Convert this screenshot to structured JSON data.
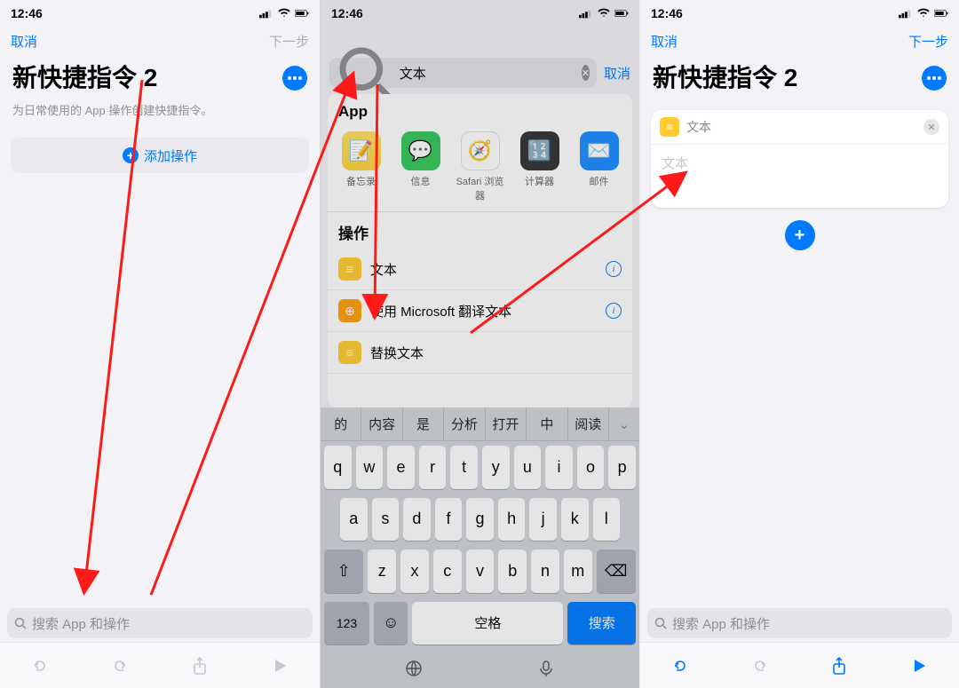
{
  "status": {
    "time": "12:46"
  },
  "nav": {
    "cancel": "取消",
    "next": "下一步"
  },
  "s1": {
    "title": "新快捷指令 2",
    "subtitle": "为日常使用的 App 操作创建快捷指令。",
    "add_action": "添加操作",
    "search_placeholder": "搜索 App 和操作"
  },
  "s2": {
    "search_value": "文本",
    "cancel": "取消",
    "section_app": "App",
    "apps": [
      "备忘录",
      "信息",
      "Safari 浏览器",
      "计算器",
      "邮件"
    ],
    "section_actions": "操作",
    "actions": [
      "文本",
      "使用 Microsoft 翻译文本",
      "替换文本"
    ],
    "candidates": [
      "的",
      "内容",
      "是",
      "分析",
      "打开",
      "中",
      "阅读"
    ],
    "kb_rows": [
      [
        "q",
        "w",
        "e",
        "r",
        "t",
        "y",
        "u",
        "i",
        "o",
        "p"
      ],
      [
        "a",
        "s",
        "d",
        "f",
        "g",
        "h",
        "j",
        "k",
        "l"
      ],
      [
        "z",
        "x",
        "c",
        "v",
        "b",
        "n",
        "m"
      ]
    ],
    "kb_123": "123",
    "kb_space": "空格",
    "kb_search": "搜索"
  },
  "s3": {
    "title": "新快捷指令 2",
    "card_title": "文本",
    "card_placeholder": "文本",
    "search_placeholder": "搜索 App 和操作"
  }
}
